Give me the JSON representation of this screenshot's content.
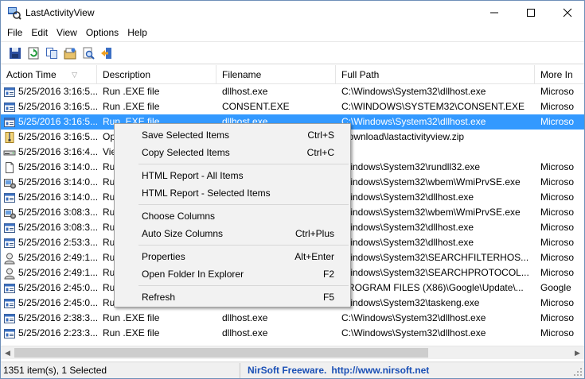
{
  "window": {
    "title": "LastActivityView"
  },
  "menu": [
    "File",
    "Edit",
    "View",
    "Options",
    "Help"
  ],
  "toolbar_icons": [
    "save-icon",
    "refresh-icon",
    "copy-icon",
    "html-report-icon",
    "find-icon",
    "exit-icon"
  ],
  "columns": [
    "Action Time",
    "Description",
    "Filename",
    "Full Path",
    "More In"
  ],
  "rows": [
    {
      "time": "5/25/2016 3:16:5...",
      "desc": "Run .EXE file",
      "file": "dllhost.exe",
      "path": "C:\\Windows\\System32\\dllhost.exe",
      "more": "Microso",
      "icon": "app"
    },
    {
      "time": "5/25/2016 3:16:5...",
      "desc": "Run .EXE file",
      "file": "CONSENT.EXE",
      "path": "C:\\WINDOWS\\SYSTEM32\\CONSENT.EXE",
      "more": "Microso",
      "icon": "app"
    },
    {
      "time": "5/25/2016 3:16:5...",
      "desc": "Run .EXE file",
      "file": "dllhost.exe",
      "path": "C:\\Windows\\System32\\dllhost.exe",
      "more": "Microso",
      "icon": "app",
      "selected": true
    },
    {
      "time": "5/25/2016 3:16:5...",
      "desc": "Op",
      "file": "",
      "path": "Download\\lastactivityview.zip",
      "more": "",
      "icon": "zip"
    },
    {
      "time": "5/25/2016 3:16:4...",
      "desc": "Vie",
      "file": "",
      "path": "",
      "more": "",
      "icon": "drive"
    },
    {
      "time": "5/25/2016 3:14:0...",
      "desc": "Ru",
      "file": "",
      "path": "Windows\\System32\\rundll32.exe",
      "more": "Microso",
      "icon": "doc"
    },
    {
      "time": "5/25/2016 3:14:0...",
      "desc": "Ru",
      "file": "",
      "path": "Windows\\System32\\wbem\\WmiPrvSE.exe",
      "more": "Microso",
      "icon": "wmi"
    },
    {
      "time": "5/25/2016 3:14:0...",
      "desc": "Ru",
      "file": "",
      "path": "Windows\\System32\\dllhost.exe",
      "more": "Microso",
      "icon": "app"
    },
    {
      "time": "5/25/2016 3:08:3...",
      "desc": "Ru",
      "file": "",
      "path": "Windows\\System32\\wbem\\WmiPrvSE.exe",
      "more": "Microso",
      "icon": "wmi"
    },
    {
      "time": "5/25/2016 3:08:3...",
      "desc": "Ru",
      "file": "",
      "path": "Windows\\System32\\dllhost.exe",
      "more": "Microso",
      "icon": "app"
    },
    {
      "time": "5/25/2016 2:53:3...",
      "desc": "Ru",
      "file": "",
      "path": "Windows\\System32\\dllhost.exe",
      "more": "Microso",
      "icon": "app"
    },
    {
      "time": "5/25/2016 2:49:1...",
      "desc": "Ru",
      "file": "",
      "path": "Windows\\System32\\SEARCHFILTERHOS...",
      "more": "Microso",
      "icon": "user"
    },
    {
      "time": "5/25/2016 2:49:1...",
      "desc": "Ru",
      "file": "",
      "path": "Windows\\System32\\SEARCHPROTOCOL...",
      "more": "Microso",
      "icon": "user"
    },
    {
      "time": "5/25/2016 2:45:0...",
      "desc": "Ru",
      "file": "",
      "path": "PROGRAM FILES (X86)\\Google\\Update\\...",
      "more": "Google",
      "icon": "app"
    },
    {
      "time": "5/25/2016 2:45:0...",
      "desc": "Ru",
      "file": "",
      "path": "Windows\\System32\\taskeng.exe",
      "more": "Microso",
      "icon": "app"
    },
    {
      "time": "5/25/2016 2:38:3...",
      "desc": "Run .EXE file",
      "file": "dllhost.exe",
      "path": "C:\\Windows\\System32\\dllhost.exe",
      "more": "Microso",
      "icon": "app"
    },
    {
      "time": "5/25/2016 2:23:3...",
      "desc": "Run .EXE file",
      "file": "dllhost.exe",
      "path": "C:\\Windows\\System32\\dllhost.exe",
      "more": "Microso",
      "icon": "app"
    }
  ],
  "context_menu": {
    "groups": [
      [
        {
          "label": "Save Selected Items",
          "shortcut": "Ctrl+S"
        },
        {
          "label": "Copy Selected Items",
          "shortcut": "Ctrl+C"
        }
      ],
      [
        {
          "label": "HTML Report - All Items",
          "shortcut": ""
        },
        {
          "label": "HTML Report - Selected Items",
          "shortcut": ""
        }
      ],
      [
        {
          "label": "Choose Columns",
          "shortcut": ""
        },
        {
          "label": "Auto Size Columns",
          "shortcut": "Ctrl+Plus"
        }
      ],
      [
        {
          "label": "Properties",
          "shortcut": "Alt+Enter"
        },
        {
          "label": "Open Folder In Explorer",
          "shortcut": "F2"
        }
      ],
      [
        {
          "label": "Refresh",
          "shortcut": "F5"
        }
      ]
    ]
  },
  "status": {
    "count": "1351 item(s), 1 Selected",
    "brand": "NirSoft Freeware.",
    "url": "http://www.nirsoft.net"
  },
  "colors": {
    "selection": "#3399ff",
    "link": "#1a4fb5"
  }
}
